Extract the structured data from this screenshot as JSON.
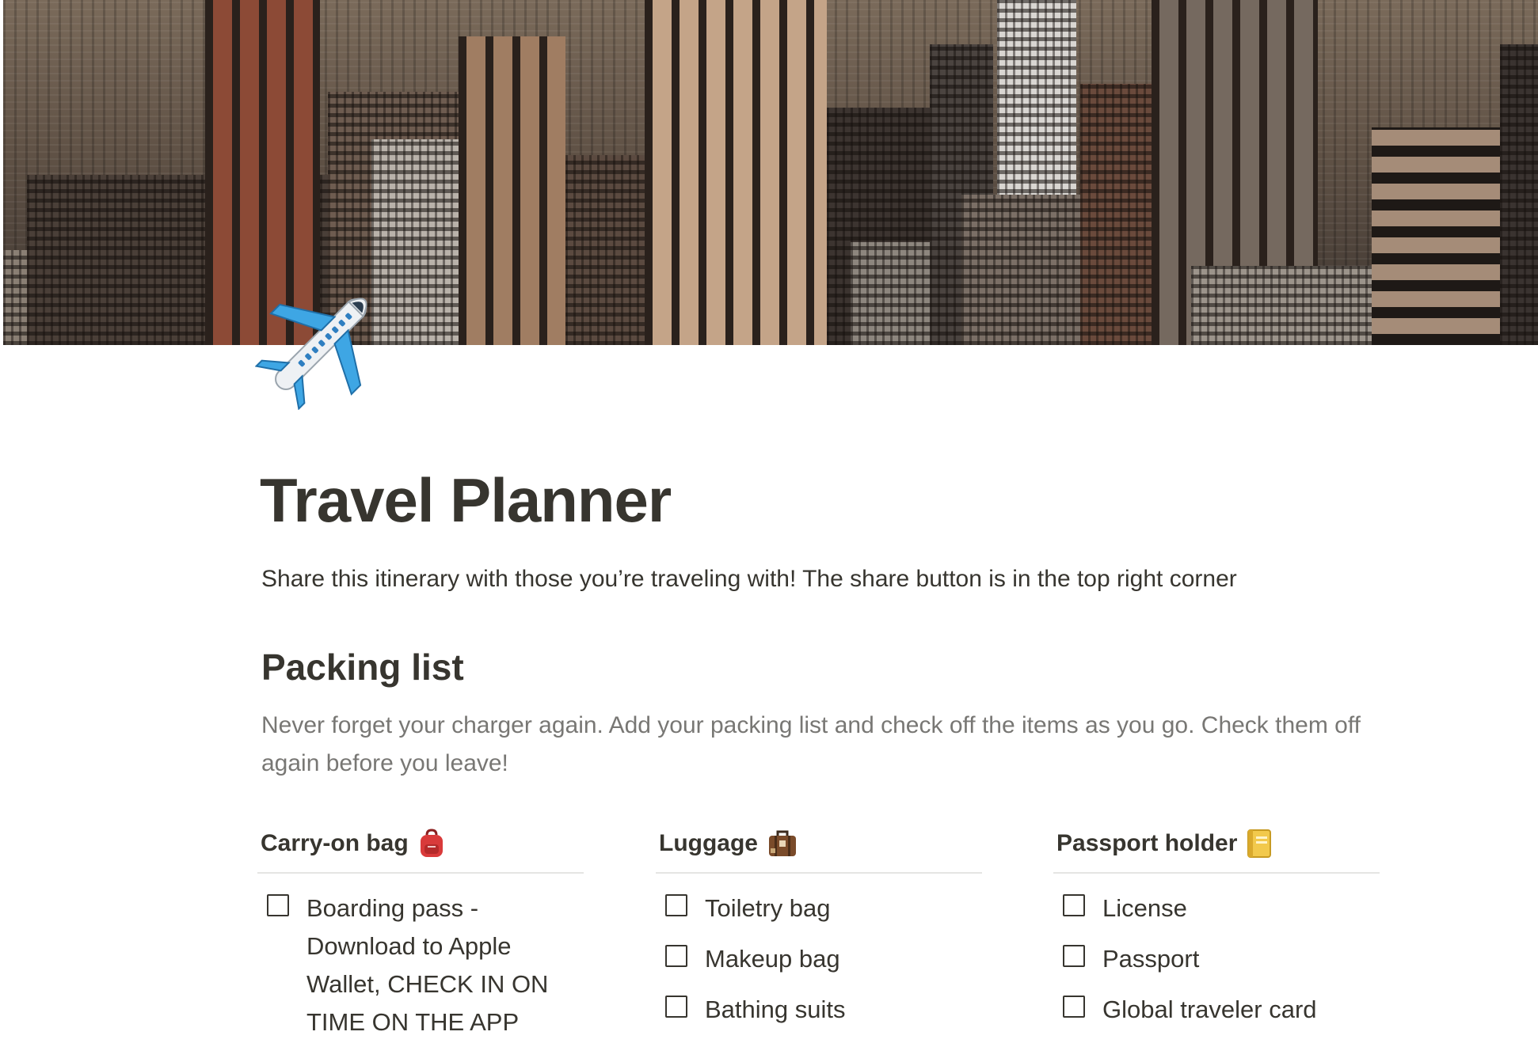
{
  "page": {
    "title": "Travel Planner",
    "subtitle": "Share this itinerary with those you’re traveling with! The share button is in the top right corner",
    "icon": "airplane-icon"
  },
  "packing": {
    "heading": "Packing list",
    "description": "Never forget your charger again. Add your packing list and check off the items as you go. Check them off again before you leave!",
    "columns": [
      {
        "title": "Carry-on bag",
        "emoji": "backpack-icon",
        "items": [
          {
            "label": "Boarding pass - Download to Apple Wallet, CHECK IN ON TIME ON THE APP",
            "checked": false
          }
        ]
      },
      {
        "title": "Luggage",
        "emoji": "suitcase-icon",
        "items": [
          {
            "label": "Toiletry bag",
            "checked": false
          },
          {
            "label": "Makeup bag",
            "checked": false
          },
          {
            "label": "Bathing suits",
            "checked": false
          }
        ]
      },
      {
        "title": "Passport holder",
        "emoji": "notebook-icon",
        "items": [
          {
            "label": "License",
            "checked": false
          },
          {
            "label": "Passport",
            "checked": false
          },
          {
            "label": "Global traveler card",
            "checked": false
          }
        ]
      }
    ]
  },
  "colors": {
    "text": "#37352f",
    "muted": "#787774",
    "divider": "#e5e5e3",
    "airplane_blue": "#3ea6e4"
  }
}
